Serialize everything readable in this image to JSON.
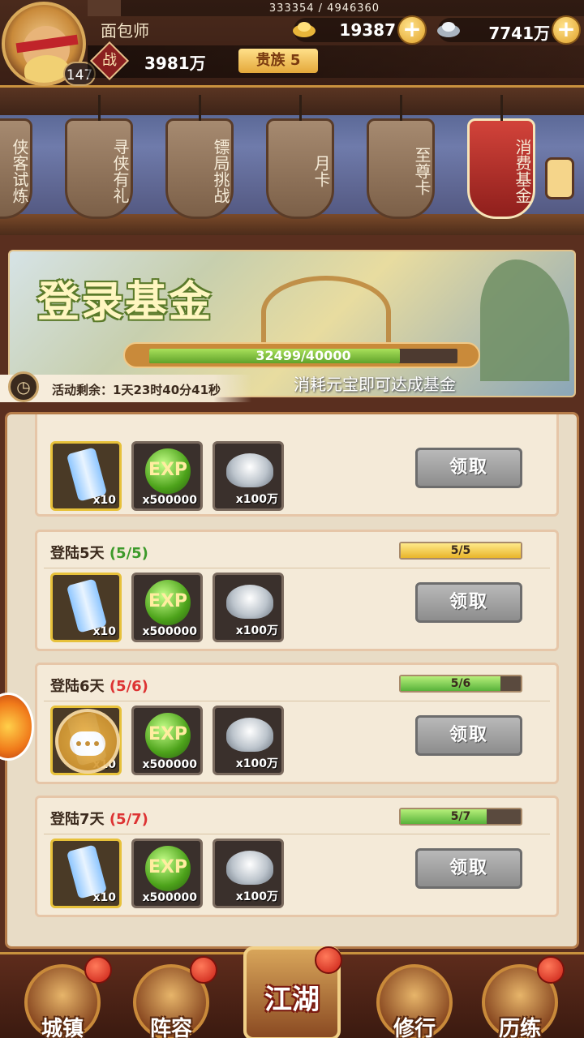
{
  "player": {
    "name": "面包师",
    "level": "147",
    "exp_text": "333354 / 4946360",
    "exp_ratio": 0.0674,
    "power_icon": "战",
    "power": "3981万",
    "vip": "贵族 5"
  },
  "currency": {
    "gold": "19387",
    "silver": "7741万"
  },
  "tabs": [
    {
      "label": "侠客试炼",
      "partial": true
    },
    {
      "label": "寻侠有礼"
    },
    {
      "label": "镖局挑战"
    },
    {
      "label": "月卡"
    },
    {
      "label": "至尊卡"
    },
    {
      "label": "消费基金",
      "active": true
    }
  ],
  "fund": {
    "title": "登录基金",
    "progress_text": "32499/40000",
    "progress_ratio": 0.8125,
    "hint": "消耗元宝即可达成基金",
    "timer": "活动剩余：1天23时40分41秒"
  },
  "rewards": {
    "scroll_qty": "x10",
    "exp_label": "EXP",
    "exp_qty": "x500000",
    "ingot_qty": "x100万",
    "claim_label": "领取"
  },
  "cards": [
    {
      "title": "",
      "count": "",
      "bar": "",
      "ratio": 0
    },
    {
      "title": "登陆5天",
      "count": "(5/5)",
      "bar": "5/5",
      "ratio": 1.0
    },
    {
      "title": "登陆6天",
      "count": "(5/6)",
      "bar": "5/6",
      "ratio": 0.833
    },
    {
      "title": "登陆7天",
      "count": "(5/7)",
      "bar": "5/7",
      "ratio": 0.714
    }
  ],
  "nav": {
    "town": "城镇",
    "lineup": "阵容",
    "jianghu": "江湖",
    "practice": "修行",
    "trial": "历练"
  }
}
